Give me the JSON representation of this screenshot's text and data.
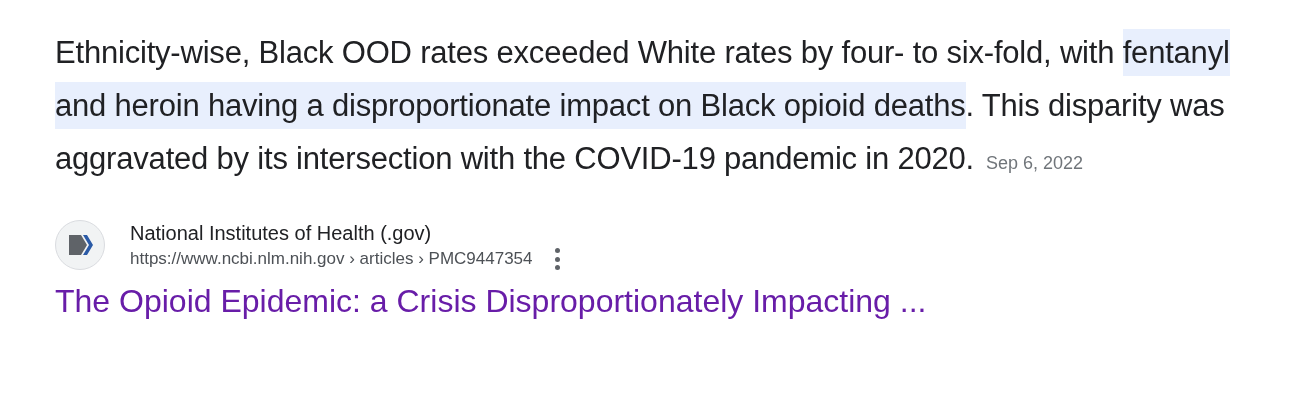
{
  "snippet": {
    "segments": [
      {
        "text": "Ethnicity-wise, Black OOD rates exceeded White rates by four- to six-fold, with ",
        "highlighted": false
      },
      {
        "text": "fentanyl and heroin having a disproportionate impact on Black opioid deaths",
        "highlighted": true
      },
      {
        "text": ". This disparity was aggravated by its intersection with the COVID-19 pandemic in 2020.",
        "highlighted": false
      }
    ],
    "date": "Sep 6, 2022"
  },
  "source": {
    "name": "National Institutes of Health (.gov)",
    "url": "https://www.ncbi.nlm.nih.gov › articles › PMC9447354"
  },
  "result_title": "The Opioid Epidemic: a Crisis Disproportionately Impacting ..."
}
